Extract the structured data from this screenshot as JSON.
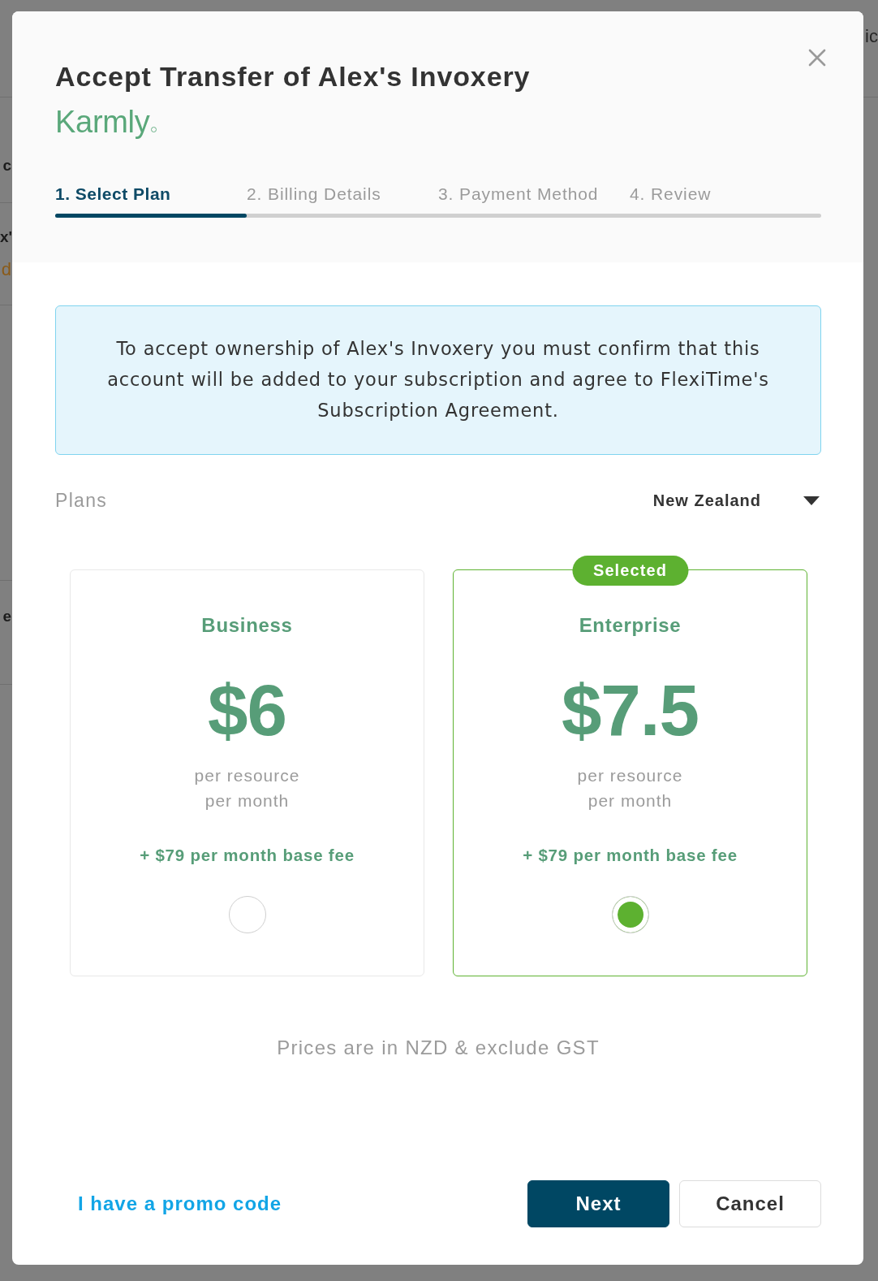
{
  "background": {
    "left": [
      {
        "items": [
          {
            "text": "c",
            "kind": "heading"
          }
        ]
      },
      {
        "items": [
          {
            "text": "x'",
            "kind": "heading"
          },
          {
            "text": "d",
            "kind": "link"
          }
        ]
      },
      {
        "items": [
          {
            "text": "e",
            "kind": "heading"
          }
        ]
      }
    ],
    "right": [
      {
        "items": [
          {
            "text": "ic",
            "kind": "body"
          }
        ]
      }
    ]
  },
  "dialog": {
    "title": "Accept Transfer of Alex's Invoxery",
    "logo": "Karmly",
    "steps": {
      "tabs": [
        {
          "label": "1. Select Plan",
          "selected": true
        },
        {
          "label": "2. Billing Details",
          "selected": false
        },
        {
          "label": "3. Payment Method",
          "selected": false
        },
        {
          "label": "4. Review",
          "selected": false
        }
      ],
      "progress": {
        "level": 0.25
      }
    },
    "notice": "To accept ownership of Alex's Invoxery you must confirm that this account will be added to your subscription and agree to FlexiTime's Subscription Agreement.",
    "plans_section": {
      "label": "Plans",
      "country": {
        "value": "New Zealand"
      },
      "selected_badge": "Selected",
      "plans": [
        {
          "name": "Business",
          "price": "$6",
          "unit_lines": [
            "per resource",
            "per month"
          ],
          "base_fee": "+ $79 per month base fee",
          "selected": false
        },
        {
          "name": "Enterprise",
          "price": "$7.5",
          "unit_lines": [
            "per resource",
            "per month"
          ],
          "base_fee": "+ $79 per month base fee",
          "selected": true
        }
      ],
      "note": "Prices are in NZD & exclude GST"
    },
    "footer": {
      "promo_link": "I have a promo code",
      "buttons": [
        {
          "label": "Next",
          "kind": "primary"
        },
        {
          "label": "Cancel",
          "kind": "secondary"
        }
      ]
    }
  }
}
